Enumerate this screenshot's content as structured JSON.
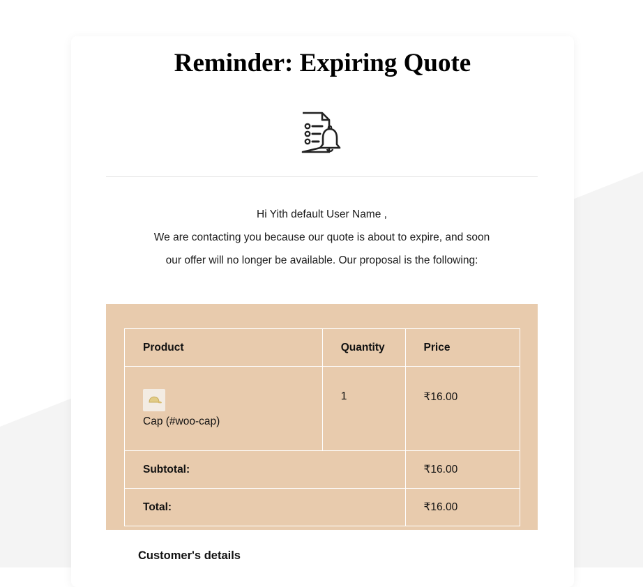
{
  "email": {
    "title": "Reminder: Expiring Quote",
    "icon": "quote-reminder-icon",
    "greeting": "Hi Yith default User Name ,",
    "message_line1": "We are contacting you because our quote is about to expire, and soon",
    "message_line2": "our offer will no longer be available. Our proposal is the following:"
  },
  "quote_table": {
    "headers": {
      "product": "Product",
      "quantity": "Quantity",
      "price": "Price"
    },
    "items": [
      {
        "thumbnail_icon": "cap-thumbnail-icon",
        "name": "Cap (#woo-cap)",
        "quantity": "1",
        "price": "₹16.00"
      }
    ],
    "subtotal_label": "Subtotal:",
    "subtotal_value": "₹16.00",
    "total_label": "Total:",
    "total_value": "₹16.00"
  },
  "customer_details": {
    "heading": "Customer's details"
  },
  "colors": {
    "table_background": "#e8cbad",
    "page_background": "#ffffff",
    "background_shape": "#f4f4f4",
    "text": "#1a1a1a"
  }
}
